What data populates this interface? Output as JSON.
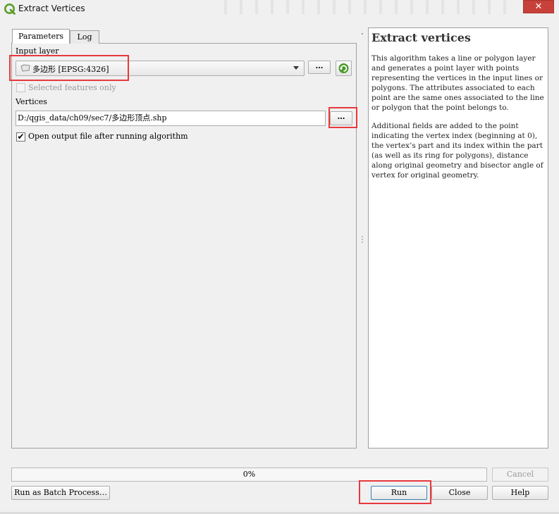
{
  "window": {
    "title": "Extract Vertices",
    "close_glyph": "✕"
  },
  "tabs": [
    {
      "label": "Parameters"
    },
    {
      "label": "Log"
    }
  ],
  "params": {
    "input_layer_label": "Input layer",
    "input_layer_value": "多边形 [EPSG:4326]",
    "layer_options_label": "…",
    "selected_only_label": "Selected features only",
    "selected_only_checked": false,
    "vertices_label": "Vertices",
    "vertices_value": "D:/qgis_data/ch09/sec7/多边形顶点.shp",
    "vertices_browse_label": "…",
    "open_output_label": "Open output file after running algorithm",
    "open_output_checked": true,
    "check_glyph": "✔"
  },
  "help": {
    "title": "Extract vertices",
    "paragraphs": [
      "This algorithm takes a line or polygon layer and generates a point layer with points representing the vertices in the input lines or polygons. The attributes associated to each point are the same ones associated to the line or polygon that the point belongs to.",
      "Additional fields are added to the point indicating the vertex index (beginning at 0), the vertex’s part and its index within the part (as well as its ring for polygons), distance along original geometry and bisector angle of vertex for original geometry."
    ]
  },
  "progress": {
    "label": "0%",
    "fraction": 0
  },
  "buttons": {
    "cancel": "Cancel",
    "batch": "Run as Batch Process…",
    "run": "Run",
    "close": "Close",
    "help": "Help"
  },
  "icons": {
    "app": "qgis-logo-icon",
    "layer": "polygon-layer-icon",
    "iterate": "iterate-icon",
    "splitter": "splitter-handle-icon"
  },
  "colors": {
    "highlight": "#e8383d",
    "qgis_green": "#5a9e2a"
  }
}
